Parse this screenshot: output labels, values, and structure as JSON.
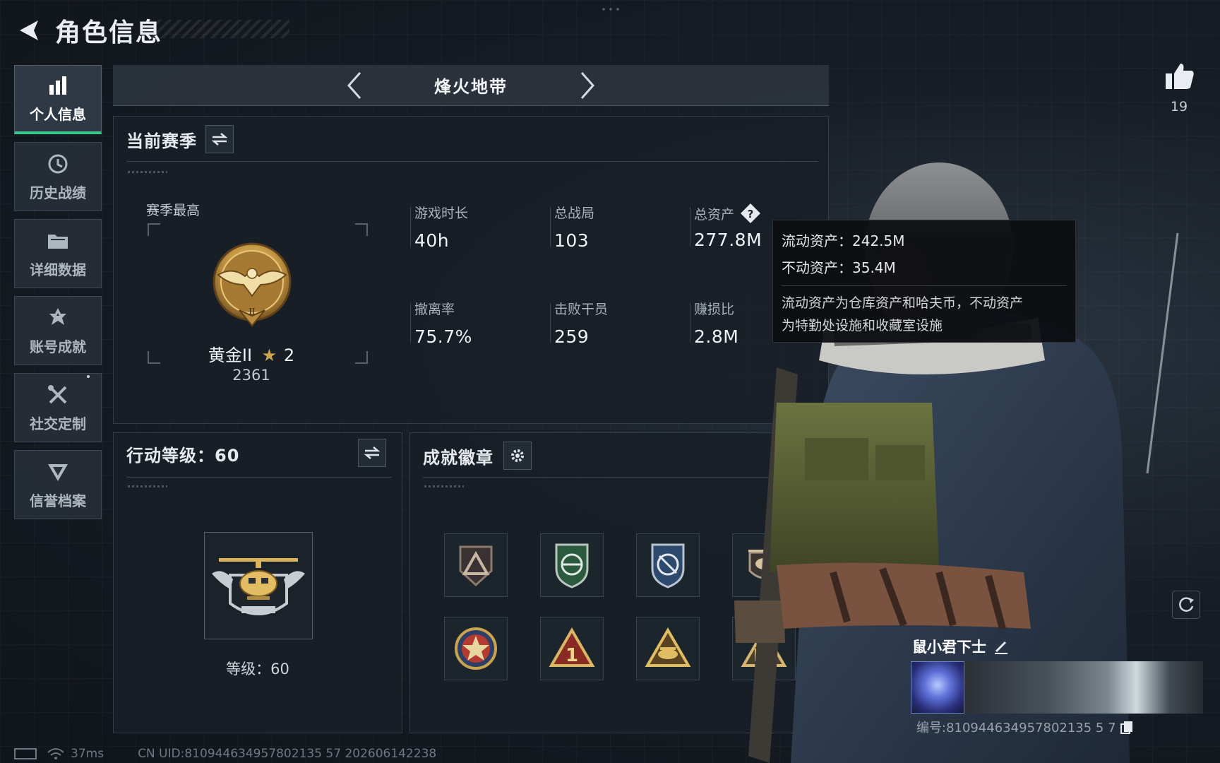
{
  "header": {
    "title": "角色信息"
  },
  "nav": [
    {
      "label": "个人信息",
      "icon": "bar-chart-icon",
      "active": true
    },
    {
      "label": "历史战绩",
      "icon": "history-icon",
      "active": false
    },
    {
      "label": "详细数据",
      "icon": "folder-icon",
      "active": false
    },
    {
      "label": "账号成就",
      "icon": "achievement-icon",
      "active": false
    },
    {
      "label": "社交定制",
      "icon": "tools-icon",
      "active": false
    },
    {
      "label": "信誉档案",
      "icon": "reputation-icon",
      "active": false
    }
  ],
  "mode": {
    "title": "烽火地带"
  },
  "season": {
    "title": "当前赛季",
    "best_label": "赛季最高",
    "rank_name": "黄金II",
    "rank_stars": "2",
    "rank_score": "2361",
    "stats": [
      {
        "label": "游戏时长",
        "value": "40h"
      },
      {
        "label": "总战局",
        "value": "103"
      },
      {
        "label": "总资产",
        "value": "277.8M"
      },
      {
        "label": "撤离率",
        "value": "75.7%"
      },
      {
        "label": "击败干员",
        "value": "259"
      },
      {
        "label": "赚损比",
        "value": "2.8M"
      }
    ]
  },
  "tooltip": {
    "liquid": "流动资产：242.5M",
    "fixed": "不动资产：35.4M",
    "desc_line1": "流动资产为仓库资产和哈夫币，不动资产",
    "desc_line2": "为特勤处设施和收藏室设施"
  },
  "level_panel": {
    "title": "行动等级：60",
    "level_text": "等级：60"
  },
  "badges_panel": {
    "title": "成就徽章",
    "badges": [
      "triangle-emblem-icon",
      "green-shield-icon",
      "blue-shield-icon",
      "helicopter-emblem-icon",
      "star-medal-icon",
      "number-one-icon",
      "gold-triangle-icon",
      "squad-triangle-icon"
    ]
  },
  "player": {
    "name": "鼠小君下士",
    "id": "编号:810944634957802135 5 7",
    "like_count": "19"
  },
  "status": {
    "ping": "37ms",
    "uid": "CN UID:810944634957802135 57 202606142238"
  },
  "colors": {
    "accent": "#39c88a",
    "gold": "#c9a34e"
  }
}
